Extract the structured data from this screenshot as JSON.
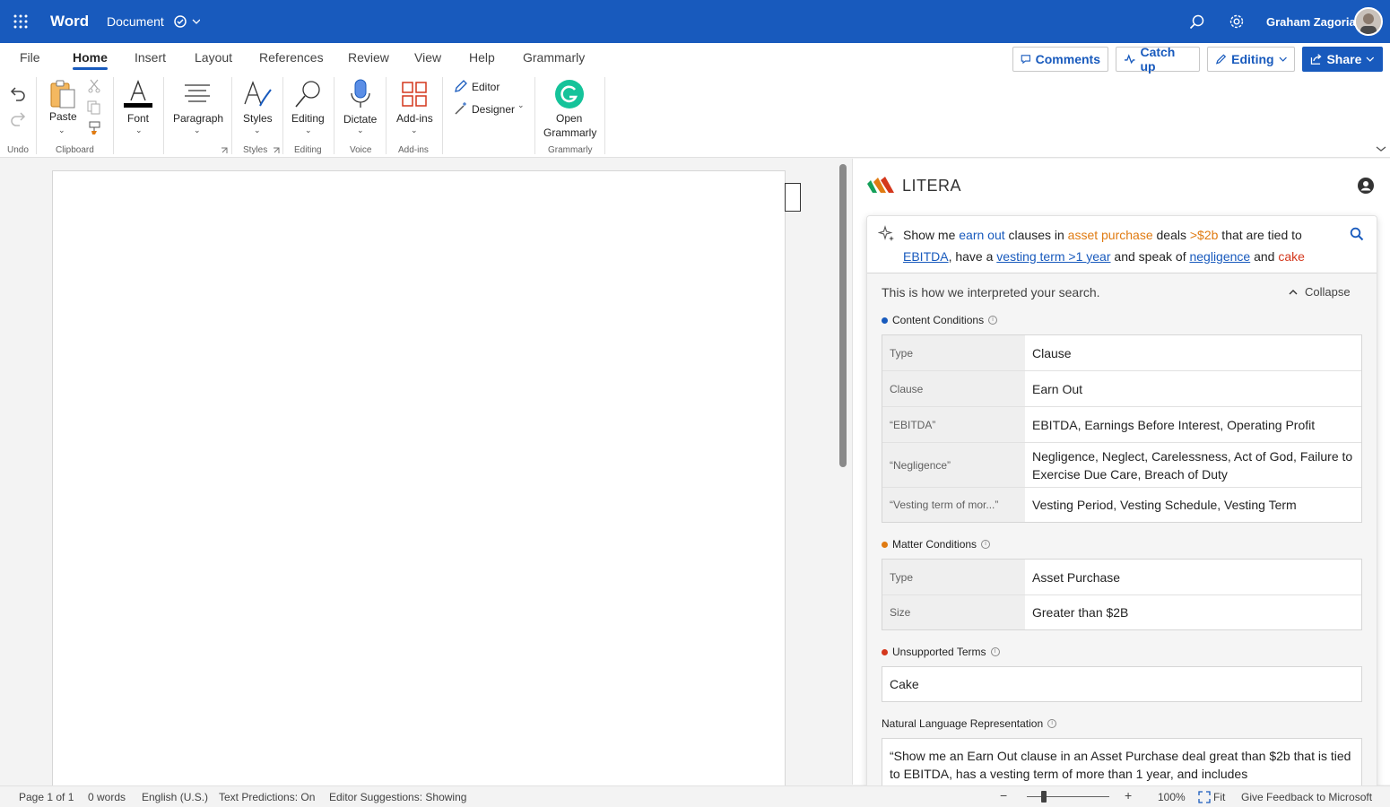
{
  "titlebar": {
    "app": "Word",
    "document": "Document",
    "user": "Graham Zagoria",
    "accent": "#185abd"
  },
  "menu": {
    "tabs": [
      "File",
      "Home",
      "Insert",
      "Layout",
      "References",
      "Review",
      "View",
      "Help",
      "Grammarly"
    ],
    "active": "Home"
  },
  "actions": {
    "comments": "Comments",
    "catchup": "Catch up",
    "editing": "Editing",
    "share": "Share"
  },
  "ribbon": {
    "paste": "Paste",
    "font": "Font",
    "paragraph": "Paragraph",
    "styles": "Styles",
    "editing": "Editing",
    "dictate": "Dictate",
    "addins": "Add-ins",
    "editor": "Editor",
    "designer": "Designer",
    "open_grammarly_1": "Open",
    "open_grammarly_2": "Grammarly",
    "groups": {
      "undo": "Undo",
      "clipboard": "Clipboard",
      "styles": "Styles",
      "editing": "Editing",
      "voice": "Voice",
      "addins": "Add-ins",
      "grammarly": "Grammarly"
    }
  },
  "litera": {
    "brand": "LITERA",
    "query": {
      "p1": "Show me ",
      "earn_out": "earn out",
      "p2": " clauses in ",
      "asset_purchase": "asset purchase",
      "p3": " deals ",
      "gt2b": ">$2b",
      "p4": " that are tied to ",
      "ebitda": "EBITDA",
      "p5": ", have a ",
      "vesting": "vesting term >1 year",
      "p6": " and speak of ",
      "negligence": "negligence",
      "p7": " and ",
      "cake": "cake"
    },
    "interpreted": "This is how we interpreted your search.",
    "collapse": "Collapse",
    "content_conditions": {
      "title": "Content Conditions",
      "color": "#185abd",
      "rows": [
        {
          "key": "Type",
          "value": "Clause"
        },
        {
          "key": "Clause",
          "value": "Earn Out"
        },
        {
          "key": "“EBITDA”",
          "value": "EBITDA, Earnings Before Interest, Operating Profit"
        },
        {
          "key": "“Negligence”",
          "value": "Negligence, Neglect, Carelessness, Act of God, Failure to Exercise Due Care, Breach of Duty"
        },
        {
          "key": "“Vesting term of mor...”",
          "value": "Vesting Period, Vesting Schedule, Vesting Term"
        }
      ]
    },
    "matter_conditions": {
      "title": "Matter Conditions",
      "color": "#e07b12",
      "rows": [
        {
          "key": "Type",
          "value": "Asset Purchase"
        },
        {
          "key": "Size",
          "value": "Greater than $2B"
        }
      ]
    },
    "unsupported": {
      "title": "Unsupported Terms",
      "color": "#d4371c",
      "value": "Cake"
    },
    "nlr": {
      "title": "Natural Language Representation",
      "value": "“Show me an Earn Out clause in an Asset Purchase deal great than $2b that is tied to EBITDA, has a vesting term of more than 1 year, and includes"
    }
  },
  "status": {
    "page": "Page 1 of 1",
    "words": "0 words",
    "language": "English (U.S.)",
    "predictions": "Text Predictions: On",
    "suggestions": "Editor Suggestions: Showing",
    "zoom": "100%",
    "fit": "Fit",
    "feedback": "Give Feedback to Microsoft"
  }
}
